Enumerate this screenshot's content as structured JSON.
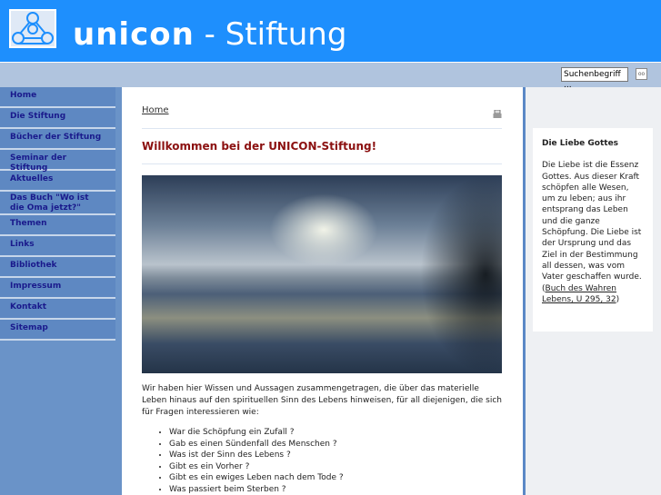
{
  "header": {
    "brand_bold": "unicon",
    "brand_rest": " - Stiftung"
  },
  "search": {
    "placeholder": "Suchenbegriff ...",
    "go_label": "oo"
  },
  "sidebar": {
    "items": [
      {
        "label": "Home"
      },
      {
        "label": "Die Stiftung"
      },
      {
        "label": "Bücher der Stiftung"
      },
      {
        "label": "Seminar der Stiftung"
      },
      {
        "label": "Aktuelles"
      },
      {
        "label": "Das Buch \"Wo ist die Oma jetzt?\""
      },
      {
        "label": "Themen"
      },
      {
        "label": "Links"
      },
      {
        "label": "Bibliothek"
      },
      {
        "label": "Impressum"
      },
      {
        "label": "Kontakt"
      },
      {
        "label": "Sitemap"
      }
    ]
  },
  "main": {
    "breadcrumb": "Home",
    "title": "Willkommen bei der UNICON-Stiftung!",
    "intro": "Wir haben hier Wissen und Aussagen zusammengetragen, die über das materielle Leben hinaus auf den spirituellen Sinn des Lebens hinweisen, für all diejenigen, die sich für Fragen interessieren wie:",
    "questions": [
      "War die Schöpfung ein Zufall ?",
      "Gab es einen Sündenfall des Menschen ?",
      "Was ist der Sinn des Lebens ?",
      "Gibt es ein Vorher ?",
      "Gibt es ein ewiges Leben nach dem Tode ?",
      "Was passiert beim Sterben ?"
    ]
  },
  "aside": {
    "title": "Die Liebe Gottes",
    "text": "Die Liebe ist die Essenz Gottes. Aus dieser Kraft schöpfen alle Wesen, um zu leben; aus ihr entsprang das Leben und die ganze Schöpfung. Die Liebe ist der Ursprung und das Ziel in der Bestimmung all dessen, was vom Vater geschaffen wurde. (",
    "link": "Buch des Wahren Lebens, U 295, 32",
    "close": ")"
  }
}
